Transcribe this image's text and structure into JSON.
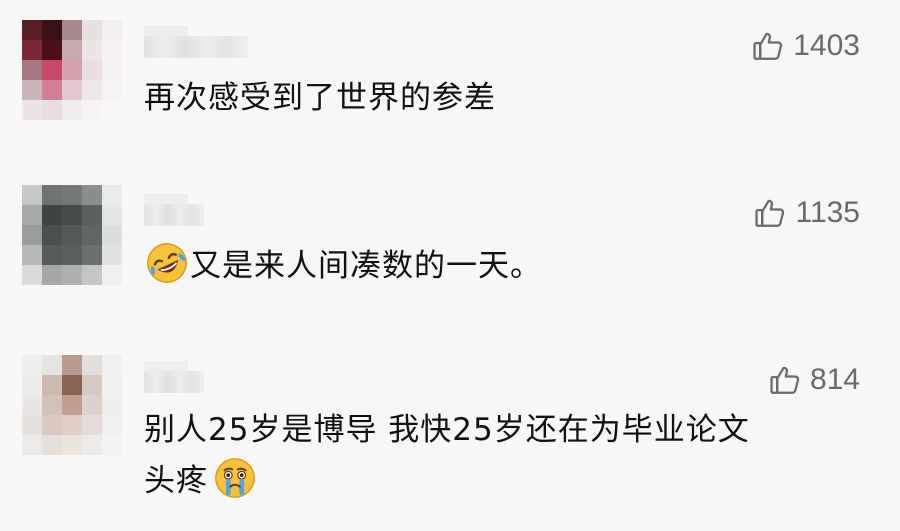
{
  "comments": [
    {
      "likes": "1403",
      "line1": "再次感受到了世界的参差",
      "line2": "",
      "emoji_before": "",
      "emoji_after": ""
    },
    {
      "likes": "1135",
      "line1": "又是来人间凑数的一天。",
      "line2": "",
      "emoji_before": "rolling-on-floor-laughing-emoji",
      "emoji_after": ""
    },
    {
      "likes": "814",
      "line1": "别人25岁是博导 我快25岁还在为毕业论文",
      "line2": "头疼",
      "emoji_before": "",
      "emoji_after": "crying-face-emoji"
    }
  ],
  "icons": {
    "like": "thumbs-up-icon"
  },
  "colors": {
    "background": "#f7f7f7",
    "text": "#111111",
    "like_count": "#6a6a6a"
  }
}
